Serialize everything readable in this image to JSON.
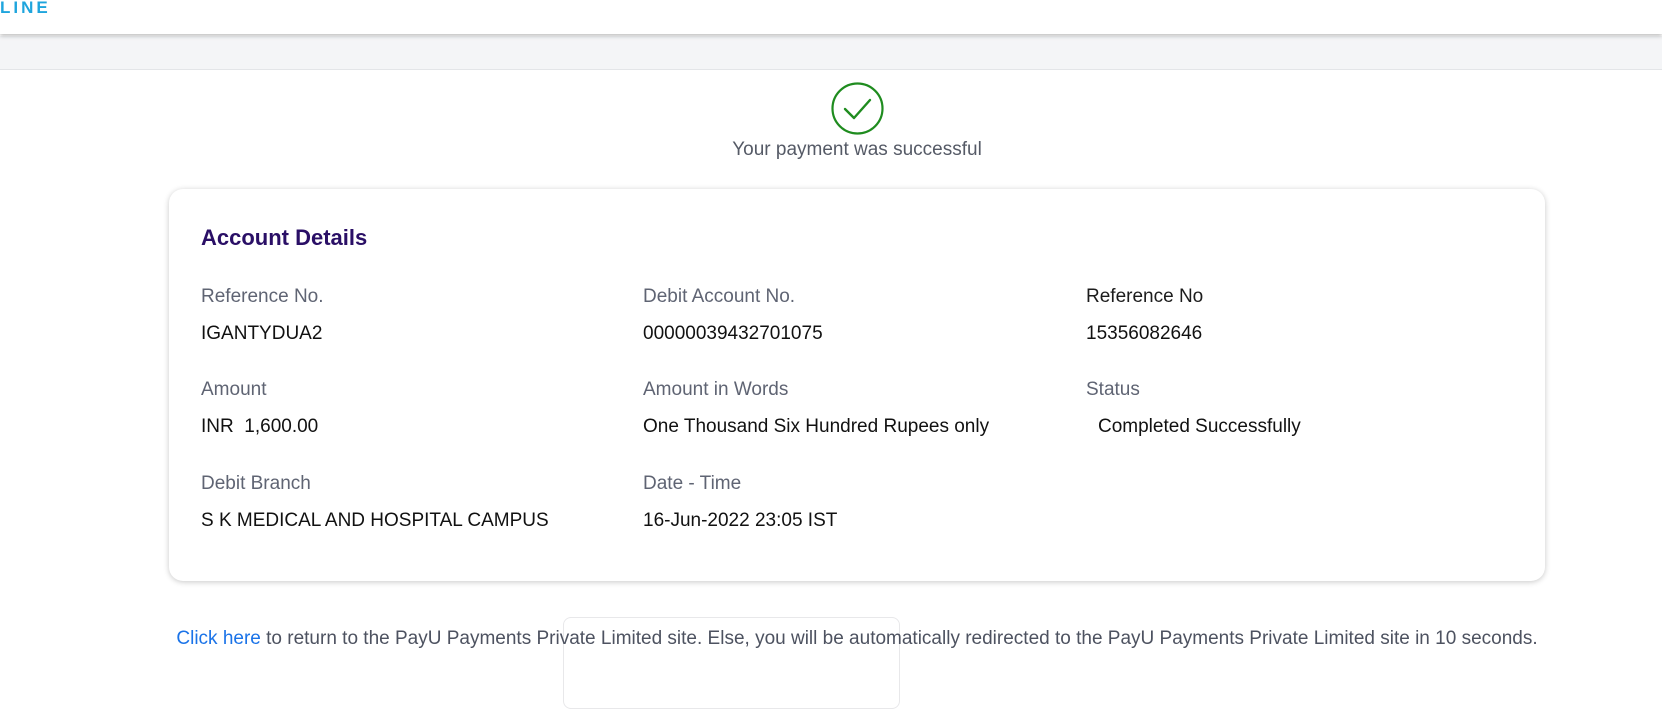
{
  "header": {
    "logo_text": "LINE"
  },
  "success": {
    "icon": "check-circle-icon",
    "message": "Your payment was successful",
    "color": "#1f8c1f"
  },
  "account": {
    "title": "Account Details",
    "fields": {
      "reference_no": {
        "label": "Reference No.",
        "value": "IGANTYDUA2"
      },
      "debit_account_no": {
        "label": "Debit Account No.",
        "value": "00000039432701075"
      },
      "reference_no_2": {
        "label": "Reference No",
        "value": "15356082646"
      },
      "amount": {
        "label": "Amount",
        "value": "INR  1,600.00"
      },
      "amount_in_words": {
        "label": "Amount in Words",
        "value": "One Thousand Six Hundred Rupees only"
      },
      "status": {
        "label": "Status",
        "value": "Completed Successfully"
      },
      "debit_branch": {
        "label": "Debit Branch",
        "value": "S K MEDICAL AND HOSPITAL CAMPUS"
      },
      "date_time": {
        "label": "Date - Time",
        "value": "16-Jun-2022 23:05 IST"
      }
    }
  },
  "footer": {
    "link_text": "Click here",
    "message": " to return to the PayU Payments Private Limited site. Else, you will be automatically redirected to the PayU Payments Private Limited site in 10 seconds."
  },
  "colors": {
    "accent_title": "#2a0f66",
    "link": "#1a73e8",
    "logo": "#1fa5dd"
  }
}
